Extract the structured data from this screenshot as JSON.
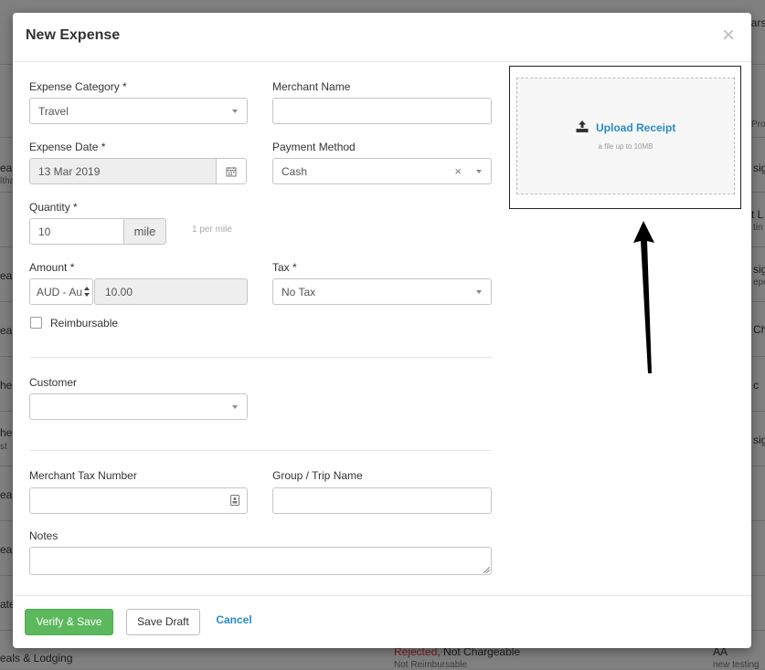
{
  "modal": {
    "title": "New Expense",
    "close_label": "×"
  },
  "form": {
    "category": {
      "label": "Expense Category *",
      "value": "Travel"
    },
    "merchant": {
      "label": "Merchant Name",
      "value": ""
    },
    "date": {
      "label": "Expense Date *",
      "value": "13 Mar 2019"
    },
    "payment": {
      "label": "Payment Method",
      "value": "Cash",
      "clear": "×"
    },
    "quantity": {
      "label": "Quantity *",
      "value": "10",
      "unit": "mile",
      "hint": "1 per mile"
    },
    "amount": {
      "label": "Amount *",
      "currency": "AUD - Au",
      "value": "10.00"
    },
    "tax": {
      "label": "Tax *",
      "value": "No Tax"
    },
    "reimbursable": {
      "label": "Reimbursable",
      "checked": false
    },
    "customer": {
      "label": "Customer",
      "value": ""
    },
    "merchant_tax_number": {
      "label": "Merchant Tax Number",
      "value": ""
    },
    "group_trip": {
      "label": "Group / Trip Name",
      "value": ""
    },
    "notes": {
      "label": "Notes",
      "value": ""
    }
  },
  "upload": {
    "label": "Upload Receipt",
    "hint": "a file up to 10MB"
  },
  "footer": {
    "verify_save": "Verify & Save",
    "save_draft": "Save Draft",
    "cancel": "Cancel"
  },
  "background": {
    "fragments": [
      "ears",
      "Pro",
      "eal",
      "sig",
      "ltha",
      "rt L",
      "tin",
      "eal",
      "sig",
      "epo",
      "Cha",
      "eal",
      "he",
      "c",
      "he",
      "sig",
      "st",
      "ea",
      "eal",
      "ate"
    ],
    "bottom_row": {
      "category": "eals & Lodging",
      "status_rejected": "Rejected",
      "status_rest": ", Not Chargeable",
      "status_sub": "Not Reimbursable",
      "owner": "AA",
      "owner_sub": "new testing"
    }
  },
  "colors": {
    "primary": "#5cb85c",
    "link": "#2a8bc9",
    "overlay": "#808080"
  }
}
